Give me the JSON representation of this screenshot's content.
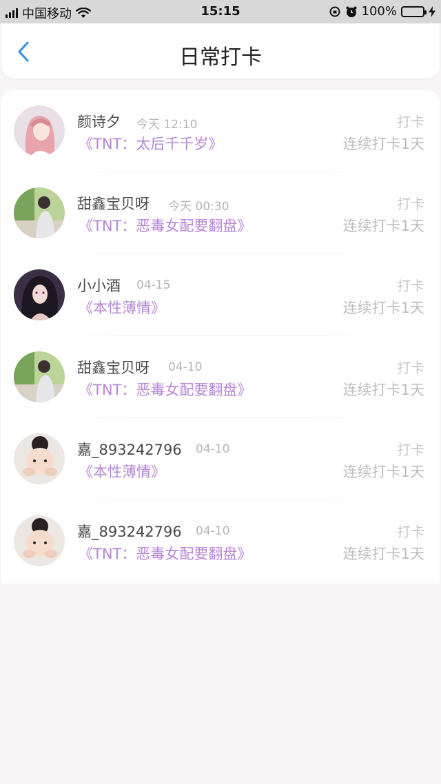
{
  "status_bar": {
    "carrier": "中国移动",
    "time": "15:15",
    "battery": "100%"
  },
  "header": {
    "title": "日常打卡",
    "back_icon": "chevron-left-icon"
  },
  "colors": {
    "accent": "#3a96e0",
    "book_title": "#b686d6",
    "battery_fill": "#4cd964"
  },
  "checkins": [
    {
      "user": "颜诗夕",
      "time": "今天 12:10",
      "book": "《TNT：太后千千岁》",
      "action": "打卡",
      "streak": "连续打卡1天"
    },
    {
      "user": "甜鑫宝贝呀",
      "time": "今天 00:30",
      "book": "《TNT：恶毒女配要翻盘》",
      "action": "打卡",
      "streak": "连续打卡1天"
    },
    {
      "user": "小小酒",
      "time": "04-15",
      "book": "《本性薄情》",
      "action": "打卡",
      "streak": "连续打卡1天"
    },
    {
      "user": "甜鑫宝贝呀",
      "time": "04-10",
      "book": "《TNT：恶毒女配要翻盘》",
      "action": "打卡",
      "streak": "连续打卡1天"
    },
    {
      "user": "嘉_893242796",
      "time": "04-10",
      "book": "《本性薄情》",
      "action": "打卡",
      "streak": "连续打卡1天"
    },
    {
      "user": "嘉_893242796",
      "time": "04-10",
      "book": "《TNT：恶毒女配要翻盘》",
      "action": "打卡",
      "streak": "连续打卡1天"
    }
  ]
}
